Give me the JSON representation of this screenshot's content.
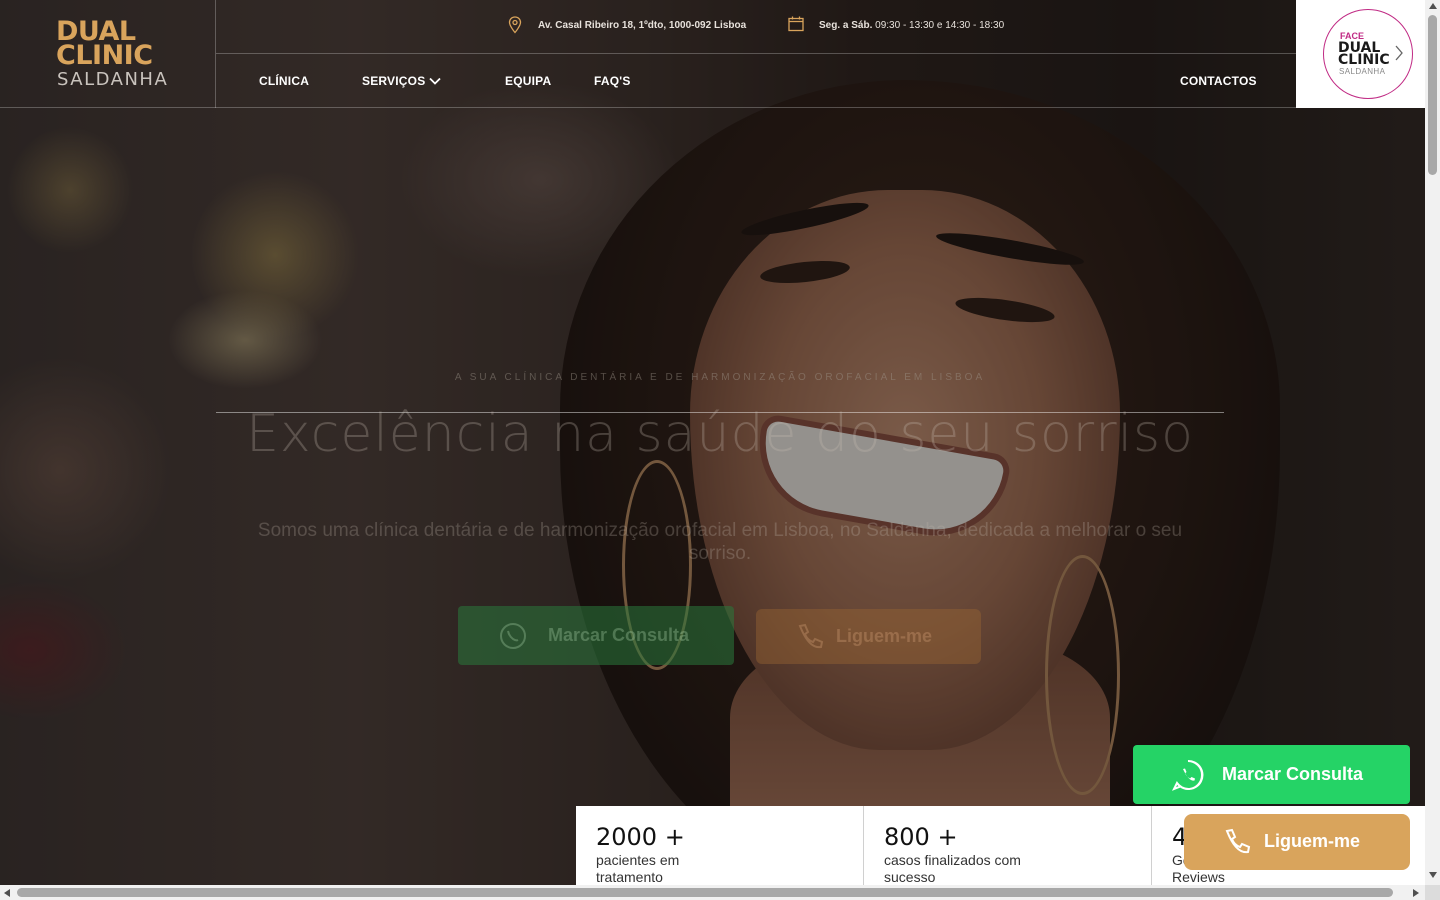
{
  "brand": {
    "logo_line1": "DUAL",
    "logo_line2": "CLINIC",
    "logo_line3": "SALDANHA",
    "accent_color": "#d9a45c"
  },
  "topbar": {
    "address": "Av. Casal Ribeiro 18, 1ºdto, 1000-092 Lisboa",
    "hours_days": "Seg. a Sáb.",
    "hours_times": " 09:30 - 13:30 e 14:30 - 18:30",
    "address_icon": "map-pin-icon",
    "hours_icon": "calendar-icon"
  },
  "nav": {
    "items": [
      {
        "label": "CLÍNICA"
      },
      {
        "label": "SERVIÇOS",
        "has_dropdown": true
      },
      {
        "label": "EQUIPA"
      },
      {
        "label": "FAQ'S"
      },
      {
        "label": "CONTACTOS"
      }
    ]
  },
  "face_badge": {
    "line1": "FACE",
    "line2": "DUAL",
    "line3": "CLINIC",
    "line4": "SALDANHA",
    "color": "#c02a84"
  },
  "hero": {
    "tagline": "A SUA CLÍNICA DENTÁRIA E DE HARMONIZAÇÃO OROFACIAL EM LISBOA",
    "headline": "Excelência na saúde do seu sorriso",
    "subtext": "Somos uma clínica dentária e de harmonização orofacial em Lisboa, no Saldanha, dedicada a melhorar o seu sorriso.",
    "button_whatsapp": "Marcar Consulta",
    "button_call": "Liguem-me"
  },
  "stats": [
    {
      "number": "2000 +",
      "label": "pacientes em tratamento"
    },
    {
      "number": "800 +",
      "label": "casos finalizados com sucesso"
    },
    {
      "number": "4",
      "label": "Google Reviews",
      "label_visible": "Go\nReviews"
    }
  ],
  "floating": {
    "whatsapp_label": "Marcar Consulta",
    "whatsapp_color": "#25d366",
    "call_label": "Liguem-me",
    "call_color": "#d9a45c"
  }
}
